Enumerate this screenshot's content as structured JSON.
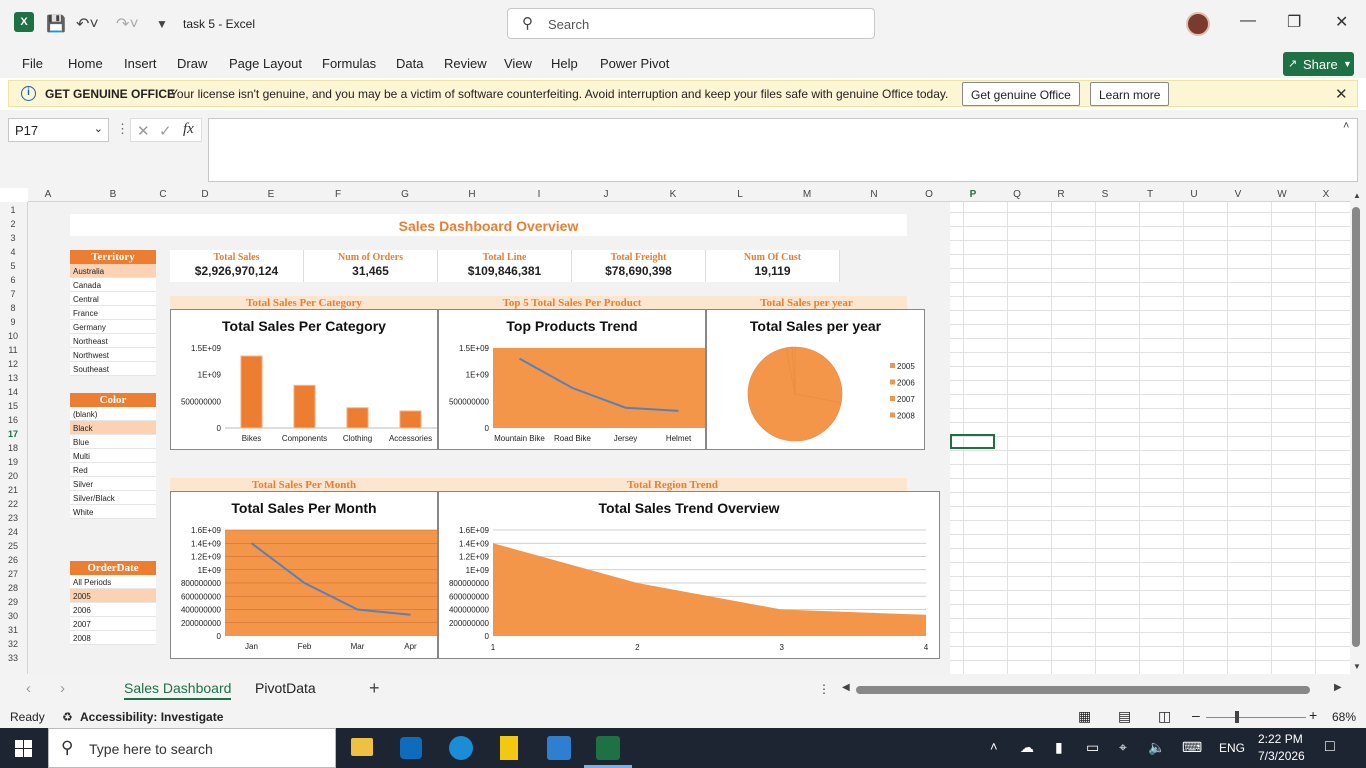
{
  "window": {
    "title": "task 5  -  Excel",
    "search_placeholder": "Search"
  },
  "menu": [
    "File",
    "Home",
    "Insert",
    "Draw",
    "Page Layout",
    "Formulas",
    "Data",
    "Review",
    "View",
    "Help",
    "Power Pivot"
  ],
  "share_label": "Share",
  "license_bar": {
    "title": "GET GENUINE OFFICE",
    "message": "Your license isn't genuine, and you may be a victim of software counterfeiting. Avoid interruption and keep your files safe with genuine Office today.",
    "get_genuine": "Get genuine Office",
    "learn_more": "Learn more"
  },
  "formula_bar": {
    "name_box": "P17",
    "fx": "fx",
    "formula": ""
  },
  "columns": [
    "A",
    "B",
    "C",
    "D",
    "E",
    "F",
    "G",
    "H",
    "I",
    "J",
    "K",
    "L",
    "M",
    "N",
    "O",
    "P",
    "Q",
    "R",
    "S",
    "T",
    "U",
    "V",
    "W",
    "X"
  ],
  "rows": [
    "1",
    "2",
    "3",
    "4",
    "5",
    "6",
    "7",
    "8",
    "9",
    "10",
    "11",
    "12",
    "13",
    "14",
    "15",
    "16",
    "17",
    "18",
    "19",
    "20",
    "21",
    "22",
    "23",
    "24",
    "25",
    "26",
    "27",
    "28",
    "29",
    "30",
    "31",
    "32",
    "33"
  ],
  "dashboard": {
    "title": "Sales Dashboard Overview",
    "kpis": [
      {
        "label": "Total Sales",
        "value": "$2,926,970,124"
      },
      {
        "label": "Num of Orders",
        "value": "31,465"
      },
      {
        "label": "Total Line",
        "value": "$109,846,381"
      },
      {
        "label": "Total Freight",
        "value": "$78,690,398"
      },
      {
        "label": "Num Of Cust",
        "value": "19,119"
      }
    ],
    "slicers": {
      "territory": {
        "title": "Territory",
        "items": [
          "Australia",
          "Canada",
          "Central",
          "France",
          "Germany",
          "Northeast",
          "Northwest",
          "Southeast"
        ],
        "selected": "Australia"
      },
      "color": {
        "title": "Color",
        "items": [
          "(blank)",
          "Black",
          "Blue",
          "Multi",
          "Red",
          "Silver",
          "Silver/Black",
          "White"
        ],
        "selected": "Black"
      },
      "orderdate": {
        "title": "OrderDate",
        "items": [
          "All Periods",
          "2005",
          "2006",
          "2007",
          "2008"
        ],
        "selected": "2005"
      }
    },
    "section_labels": {
      "category": "Total Sales Per Category",
      "product": "Top 5 Total Sales Per Product",
      "year": "Total Sales per year",
      "month": "Total Sales Per Month",
      "region": "Total Region Trend"
    }
  },
  "chart_data": [
    {
      "type": "bar",
      "title": "Total Sales Per Category",
      "categories": [
        "Bikes",
        "Components",
        "Clothing",
        "Accessories"
      ],
      "values": [
        1350000000,
        800000000,
        380000000,
        320000000
      ],
      "ylim": [
        0,
        1500000000
      ],
      "yticks": [
        "0",
        "500000000",
        "1E+09",
        "1.5E+09"
      ],
      "color": "#ed7d31"
    },
    {
      "type": "line",
      "title": "Top Products Trend",
      "categories": [
        "Mountain Bike",
        "Road Bike",
        "Jersey",
        "Helmet"
      ],
      "values": [
        1300000000,
        750000000,
        380000000,
        320000000
      ],
      "ylim": [
        0,
        1500000000
      ],
      "yticks": [
        "0",
        "500000000",
        "1E+09",
        "1.5E+09"
      ],
      "plot_bg": "#f4964a",
      "line_color": "#5b7fb8"
    },
    {
      "type": "pie",
      "title": "Total Sales per year",
      "labels": [
        "2005",
        "2006",
        "2007",
        "2008"
      ],
      "values": [
        0.28,
        0.69,
        0.02,
        0.01
      ],
      "colors": [
        "#f4964a",
        "#f4964a",
        "#f4964a",
        "#f4964a"
      ]
    },
    {
      "type": "line",
      "title": "Total Sales Per Month",
      "categories": [
        "Jan",
        "Feb",
        "Mar",
        "Apr"
      ],
      "values": [
        1400000000,
        800000000,
        400000000,
        320000000
      ],
      "ylim": [
        0,
        1600000000
      ],
      "yticks": [
        "0",
        "200000000",
        "400000000",
        "600000000",
        "800000000",
        "1E+09",
        "1.2E+09",
        "1.4E+09",
        "1.6E+09"
      ],
      "plot_bg": "#f4964a",
      "line_color": "#5b7fb8"
    },
    {
      "type": "area",
      "title": "Total Sales Trend Overview",
      "x": [
        "1",
        "2",
        "3",
        "4"
      ],
      "values": [
        1400000000,
        800000000,
        400000000,
        320000000
      ],
      "ylim": [
        0,
        1600000000
      ],
      "yticks": [
        "0",
        "200000000",
        "400000000",
        "600000000",
        "800000000",
        "1E+09",
        "1.2E+09",
        "1.4E+09",
        "1.6E+09"
      ],
      "color": "#f4964a"
    }
  ],
  "sheet_tabs": [
    "Sales Dashboard",
    "PivotData"
  ],
  "status": {
    "ready": "Ready",
    "accessibility": "Accessibility: Investigate",
    "zoom": "68%"
  },
  "taskbar": {
    "search_placeholder": "Type here to search",
    "time": "2:22 PM",
    "date": "7/3/2026",
    "lang": "ENG"
  }
}
